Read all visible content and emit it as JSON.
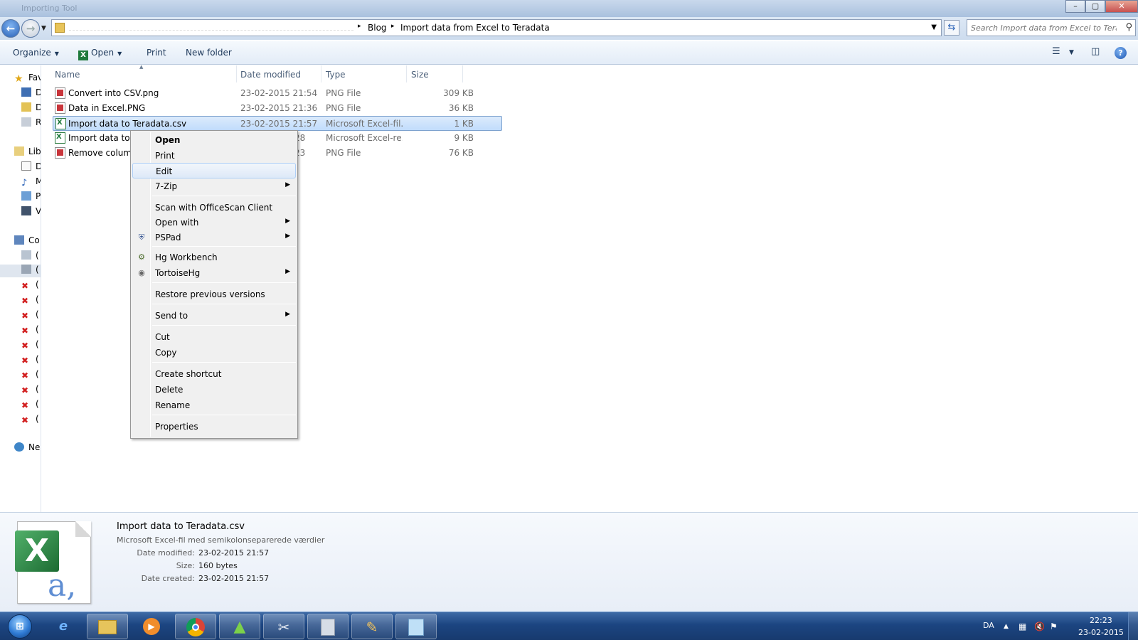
{
  "window": {
    "title": "Importing Tool",
    "buttons": {
      "minimize": "–",
      "maximize": "▢",
      "close": "✕"
    }
  },
  "address": {
    "crumbs": [
      "Blog",
      "Import data from Excel to Teradata"
    ],
    "search_placeholder": "Search Import data from Excel to Tera..."
  },
  "toolbar": {
    "organize": "Organize",
    "open": "Open",
    "print": "Print",
    "new_folder": "New folder"
  },
  "navpane": {
    "items": [
      {
        "label": "Fav",
        "icon": "star-icon"
      },
      {
        "label": "D",
        "icon": "desktop-icon"
      },
      {
        "label": "D",
        "icon": "downloads-icon"
      },
      {
        "label": "R",
        "icon": "recent-places-icon"
      },
      {
        "label": "Lib",
        "icon": "libraries-icon"
      },
      {
        "label": "D",
        "icon": "documents-icon"
      },
      {
        "label": "M",
        "icon": "music-icon"
      },
      {
        "label": "P",
        "icon": "pictures-icon"
      },
      {
        "label": "V",
        "icon": "videos-icon"
      },
      {
        "label": "Co",
        "icon": "computer-icon"
      },
      {
        "label": "(",
        "icon": "drive-icon"
      },
      {
        "label": "(",
        "icon": "drive-icon"
      },
      {
        "label": "(",
        "icon": "network-drive-disconnected-icon"
      },
      {
        "label": "(",
        "icon": "network-drive-disconnected-icon"
      },
      {
        "label": "(",
        "icon": "network-drive-disconnected-icon"
      },
      {
        "label": "(",
        "icon": "network-drive-disconnected-icon"
      },
      {
        "label": "(",
        "icon": "network-drive-disconnected-icon"
      },
      {
        "label": "(",
        "icon": "network-drive-disconnected-icon"
      },
      {
        "label": "(",
        "icon": "network-drive-disconnected-icon"
      },
      {
        "label": "(",
        "icon": "network-drive-disconnected-icon"
      },
      {
        "label": "(",
        "icon": "network-drive-disconnected-icon"
      },
      {
        "label": "(",
        "icon": "network-drive-disconnected-icon"
      },
      {
        "label": "Ne",
        "icon": "network-icon"
      }
    ]
  },
  "filelist": {
    "columns": [
      "Name",
      "Date modified",
      "Type",
      "Size"
    ],
    "rows": [
      {
        "name": "Convert into CSV.png",
        "date": "23-02-2015 21:54",
        "type": "PNG File",
        "size": "309 KB",
        "icon": "png-file-icon"
      },
      {
        "name": "Data in Excel.PNG",
        "date": "23-02-2015 21:36",
        "type": "PNG File",
        "size": "36 KB",
        "icon": "png-file-icon"
      },
      {
        "name": "Import data to Teradata.csv",
        "date": "23-02-2015 21:57",
        "type": "Microsoft Excel-fil...",
        "size": "1 KB",
        "icon": "excel-csv-icon"
      },
      {
        "name": "Import data to T",
        "date": "28",
        "type": "Microsoft Excel-re...",
        "size": "9 KB",
        "icon": "excel-file-icon"
      },
      {
        "name": "Remove column",
        "date": "23",
        "type": "PNG File",
        "size": "76 KB",
        "icon": "png-file-icon"
      }
    ]
  },
  "context_menu": {
    "items": [
      {
        "label": "Open"
      },
      {
        "label": "Print"
      },
      {
        "label": "Edit"
      },
      {
        "label": "7-Zip"
      },
      {
        "label": "Scan with OfficeScan Client"
      },
      {
        "label": "Open with"
      },
      {
        "label": "PSPad"
      },
      {
        "label": "Hg Workbench"
      },
      {
        "label": "TortoiseHg"
      },
      {
        "label": "Restore previous versions"
      },
      {
        "label": "Send to"
      },
      {
        "label": "Cut"
      },
      {
        "label": "Copy"
      },
      {
        "label": "Create shortcut"
      },
      {
        "label": "Delete"
      },
      {
        "label": "Rename"
      },
      {
        "label": "Properties"
      }
    ]
  },
  "details": {
    "name": "Import data to Teradata.csv",
    "type": "Microsoft Excel-fil med semikolonseparerede værdier",
    "date_modified_label": "Date modified:",
    "date_modified": "23-02-2015 21:57",
    "size_label": "Size:",
    "size": "160 bytes",
    "date_created_label": "Date created:",
    "date_created": "23-02-2015 21:57"
  },
  "taskbar": {
    "language": "DA",
    "time": "22:23",
    "date": "23-02-2015",
    "apps": [
      "internet-explorer-icon",
      "windows-explorer-icon",
      "media-player-icon",
      "chrome-icon",
      "network-tool-icon",
      "snipping-tool-icon",
      "calculator-icon",
      "paint-icon",
      "notepad-icon"
    ]
  }
}
